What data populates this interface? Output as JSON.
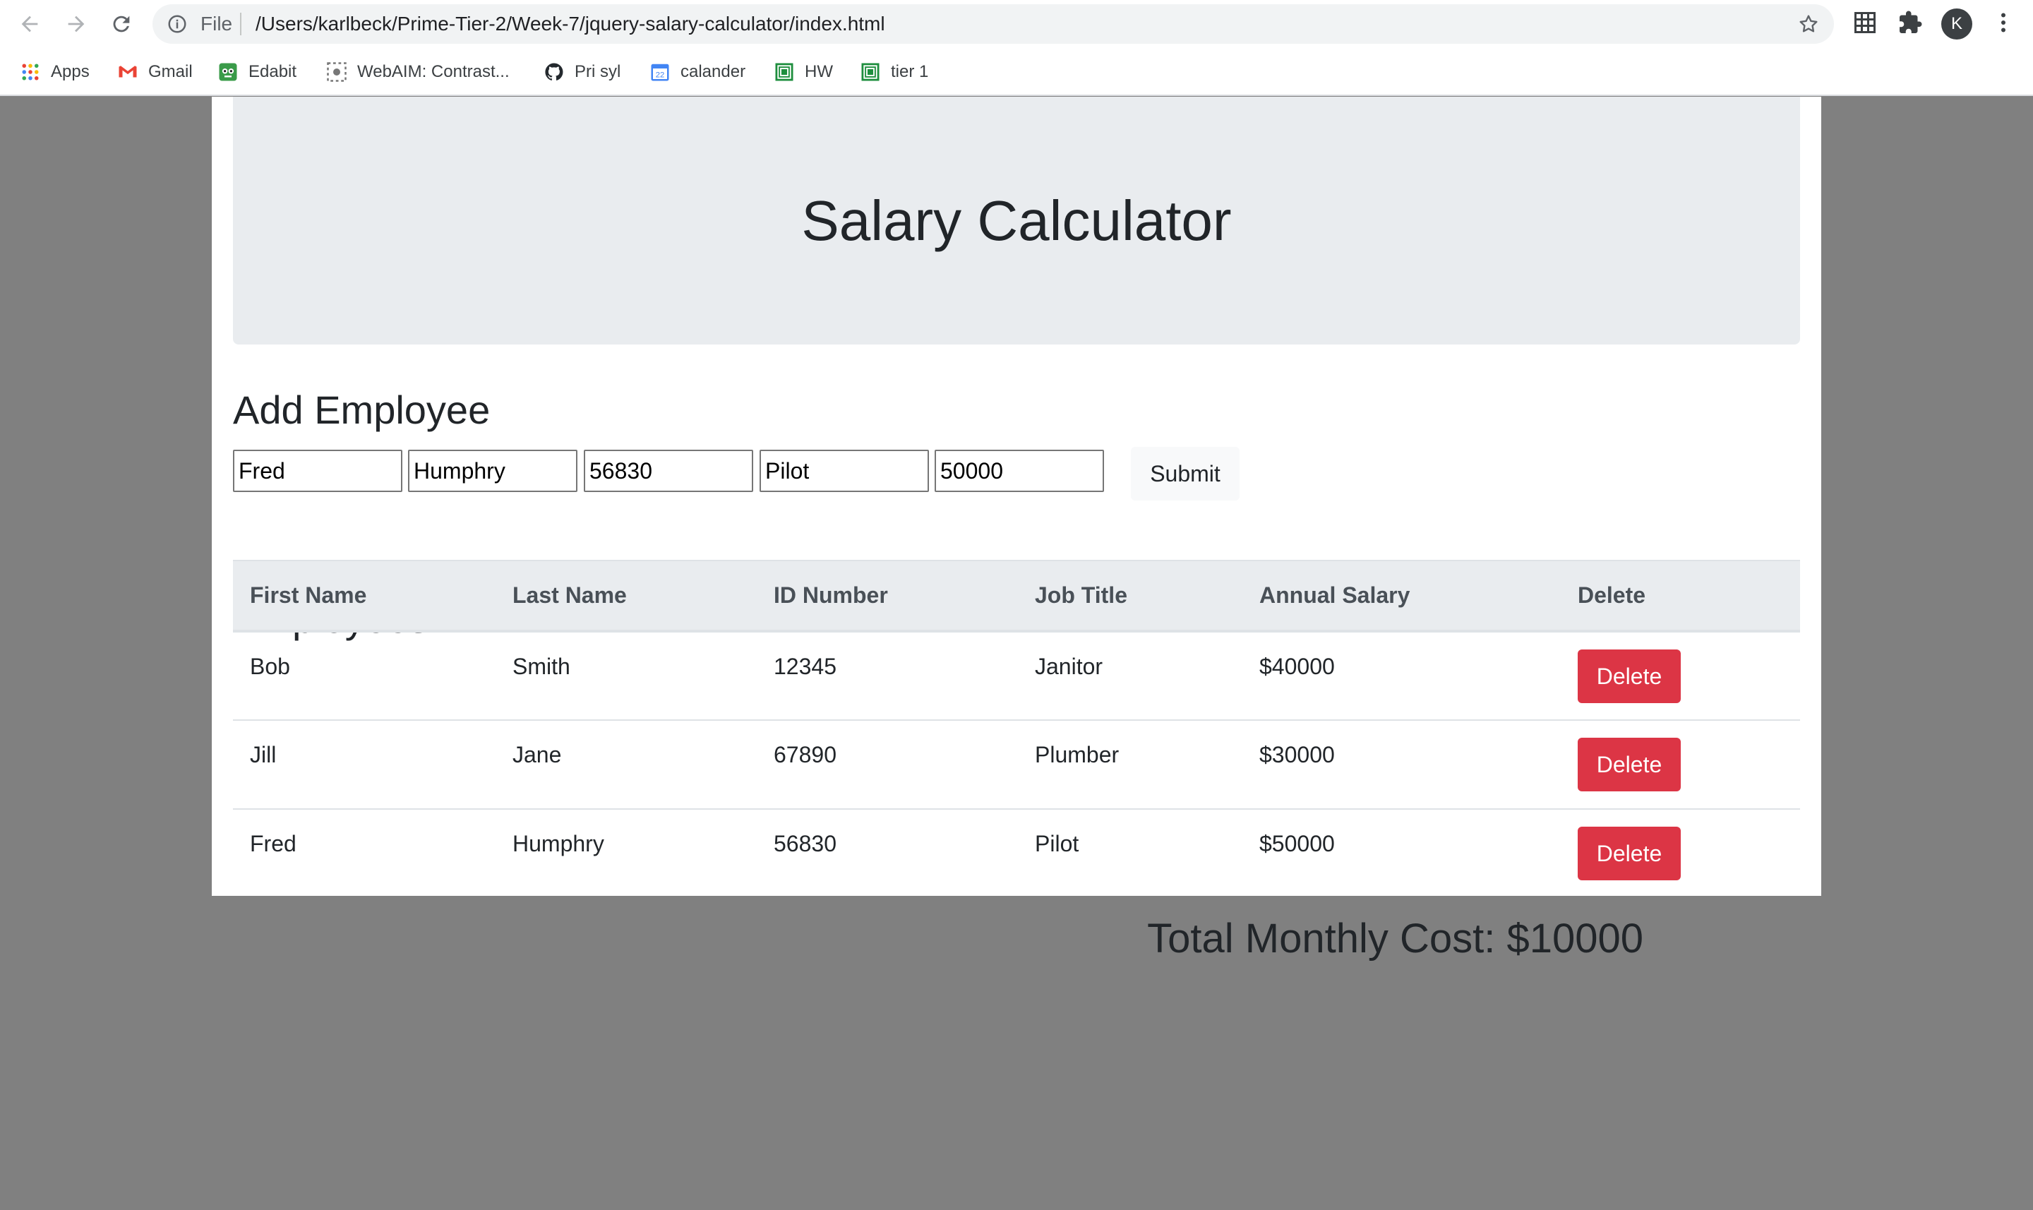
{
  "browser": {
    "scheme": "File",
    "url": "/Users/karlbeck/Prime-Tier-2/Week-7/jquery-salary-calculator/index.html",
    "avatar_letter": "K",
    "bookmarks": [
      {
        "label": "Apps",
        "icon": "apps-grid-icon"
      },
      {
        "label": "Gmail",
        "icon": "gmail-icon"
      },
      {
        "label": "Edabit",
        "icon": "edabit-icon"
      },
      {
        "label": "WebAIM: Contrast...",
        "icon": "webaim-icon"
      },
      {
        "label": "Pri syl",
        "icon": "github-icon"
      },
      {
        "label": "calander",
        "icon": "calendar-icon",
        "badge": "22"
      },
      {
        "label": "HW",
        "icon": "classroom-icon"
      },
      {
        "label": "tier 1",
        "icon": "classroom-icon"
      }
    ]
  },
  "page": {
    "title": "Salary Calculator",
    "add_heading": "Add Employee",
    "form": {
      "first_name": "Fred",
      "last_name": "Humphry",
      "id_number": "56830",
      "job_title": "Pilot",
      "annual_salary": "50000",
      "submit_label": "Submit"
    },
    "employees_heading": "Employees",
    "table": {
      "headers": [
        "First Name",
        "Last Name",
        "ID Number",
        "Job Title",
        "Annual Salary",
        "Delete"
      ],
      "rows": [
        {
          "first": "Bob",
          "last": "Smith",
          "id": "12345",
          "title": "Janitor",
          "salary": "$40000",
          "action": "Delete"
        },
        {
          "first": "Jill",
          "last": "Jane",
          "id": "67890",
          "title": "Plumber",
          "salary": "$30000",
          "action": "Delete"
        },
        {
          "first": "Fred",
          "last": "Humphry",
          "id": "56830",
          "title": "Pilot",
          "salary": "$50000",
          "action": "Delete"
        }
      ]
    },
    "total": "Total Monthly Cost: $10000"
  },
  "colors": {
    "page_background": "#808080",
    "jumbotron": "#e9ecef",
    "delete_button": "#dc3545"
  }
}
